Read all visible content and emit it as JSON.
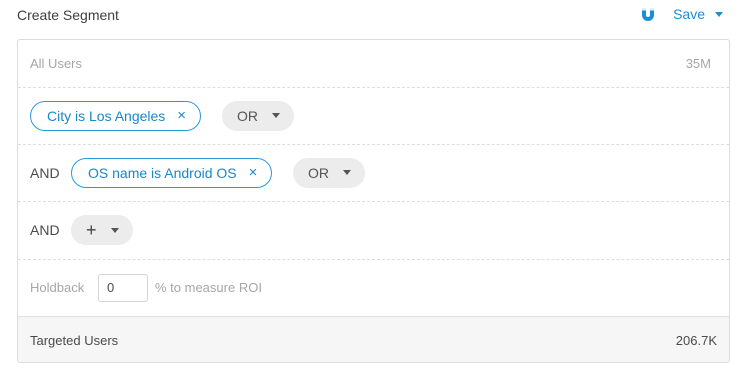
{
  "header": {
    "title": "Create Segment",
    "save_label": "Save",
    "save_icon": "magnet-icon",
    "accent_color": "#1a8fd6"
  },
  "all_users": {
    "label": "All Users",
    "count": "35M"
  },
  "conditions": [
    {
      "connector": "",
      "chip_label": "City is Los Angeles",
      "or_label": "OR"
    },
    {
      "connector": "AND",
      "chip_label": "OS name is Android OS",
      "or_label": "OR"
    }
  ],
  "add_row": {
    "connector": "AND",
    "add_symbol": "+"
  },
  "holdback": {
    "label": "Holdback",
    "value": "0",
    "suffix": "% to measure ROI"
  },
  "targeted": {
    "label": "Targeted Users",
    "count": "206.7K"
  }
}
